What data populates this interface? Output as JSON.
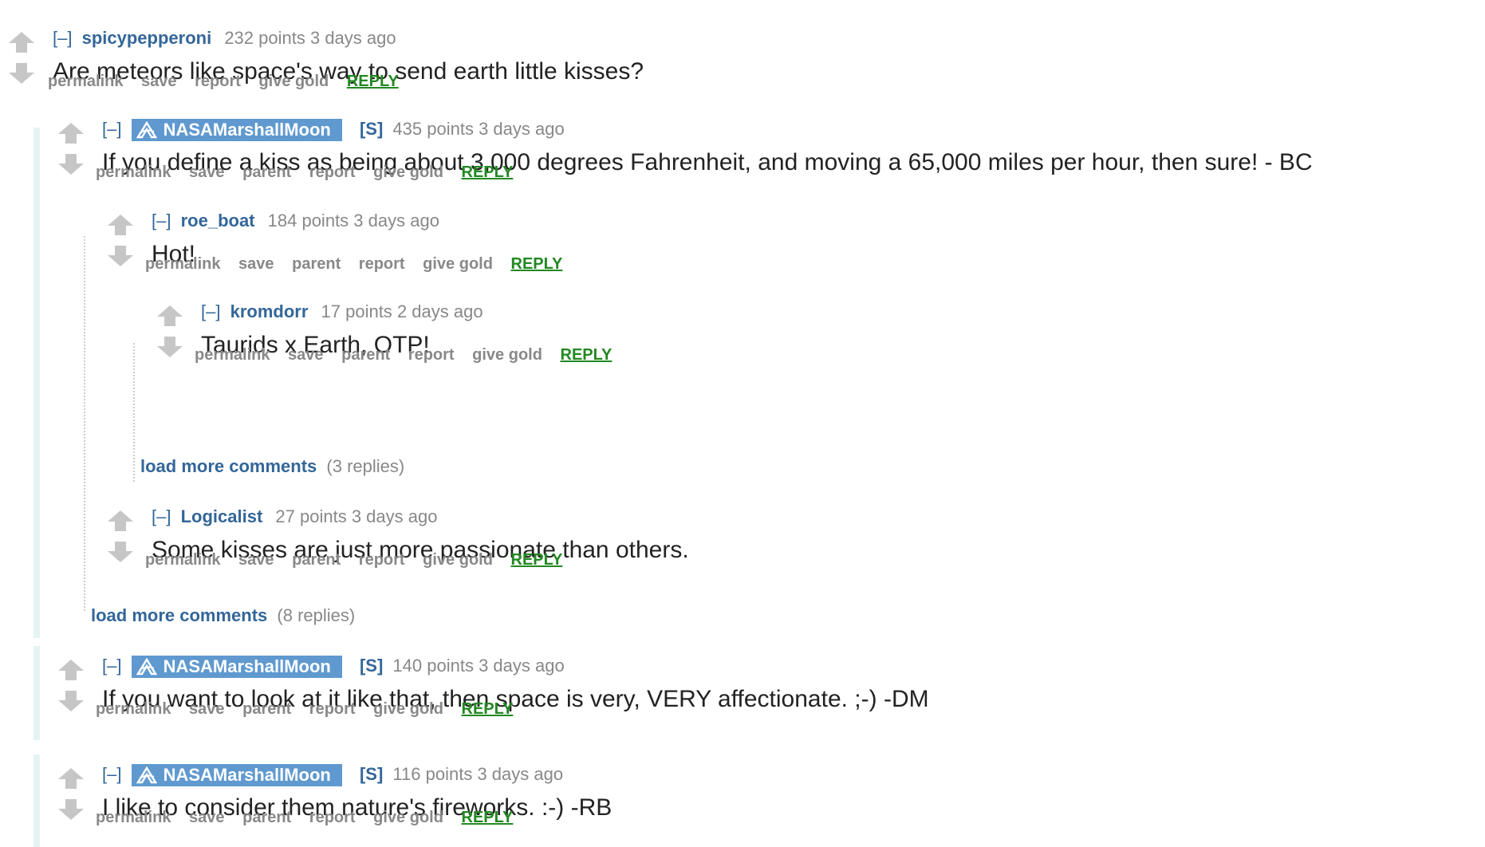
{
  "comments": [
    {
      "toggle": "[–]",
      "author": "spicypepperoni",
      "flag": "",
      "points": "232 points",
      "age": "3 days ago",
      "text": "Are meteors like space's way to send earth little kisses?",
      "actions": [
        "permalink",
        "save",
        "report",
        "give gold"
      ],
      "reply": "REPLY"
    },
    {
      "toggle": "[–]",
      "author": "NASAMarshallMoon",
      "flag": "[S]",
      "points": "435 points",
      "age": "3 days ago",
      "text": "If you define a kiss as being about 3,000 degrees Fahrenheit, and moving a 65,000 miles per hour, then sure! - BC",
      "actions": [
        "permalink",
        "save",
        "parent",
        "report",
        "give gold"
      ],
      "reply": "REPLY"
    },
    {
      "toggle": "[–]",
      "author": "roe_boat",
      "flag": "",
      "points": "184 points",
      "age": "3 days ago",
      "text": "Hot!",
      "actions": [
        "permalink",
        "save",
        "parent",
        "report",
        "give gold"
      ],
      "reply": "REPLY"
    },
    {
      "toggle": "[–]",
      "author": "kromdorr",
      "flag": "",
      "points": "17 points",
      "age": "2 days ago",
      "text": "Taurids x Earth, OTP!",
      "actions": [
        "permalink",
        "save",
        "parent",
        "report",
        "give gold"
      ],
      "reply": "REPLY"
    },
    {
      "toggle": "[–]",
      "author": "Logicalist",
      "flag": "",
      "points": "27 points",
      "age": "3 days ago",
      "text": "Some kisses are just more passionate than others.",
      "actions": [
        "permalink",
        "save",
        "parent",
        "report",
        "give gold"
      ],
      "reply": "REPLY"
    },
    {
      "toggle": "[–]",
      "author": "NASAMarshallMoon",
      "flag": "[S]",
      "points": "140 points",
      "age": "3 days ago",
      "text": "If you want to look at it like that, then space is very, VERY affectionate. ;-) -DM",
      "actions": [
        "permalink",
        "save",
        "parent",
        "report",
        "give gold"
      ],
      "reply": "REPLY"
    },
    {
      "toggle": "[–]",
      "author": "NASAMarshallMoon",
      "flag": "[S]",
      "points": "116 points",
      "age": "3 days ago",
      "text": "I like to consider them nature's fireworks. :-) -RB",
      "actions": [
        "permalink",
        "save",
        "parent",
        "report",
        "give gold"
      ],
      "reply": "REPLY"
    }
  ],
  "load_more": [
    {
      "label": "load more comments",
      "count": "(3 replies)"
    },
    {
      "label": "load more comments",
      "count": "(8 replies)"
    }
  ],
  "colors": {
    "author": "#336699",
    "op_badge": "#5f99cf",
    "reply": "#228822",
    "meta": "#888888",
    "child_bar": "#e4f2f1"
  }
}
